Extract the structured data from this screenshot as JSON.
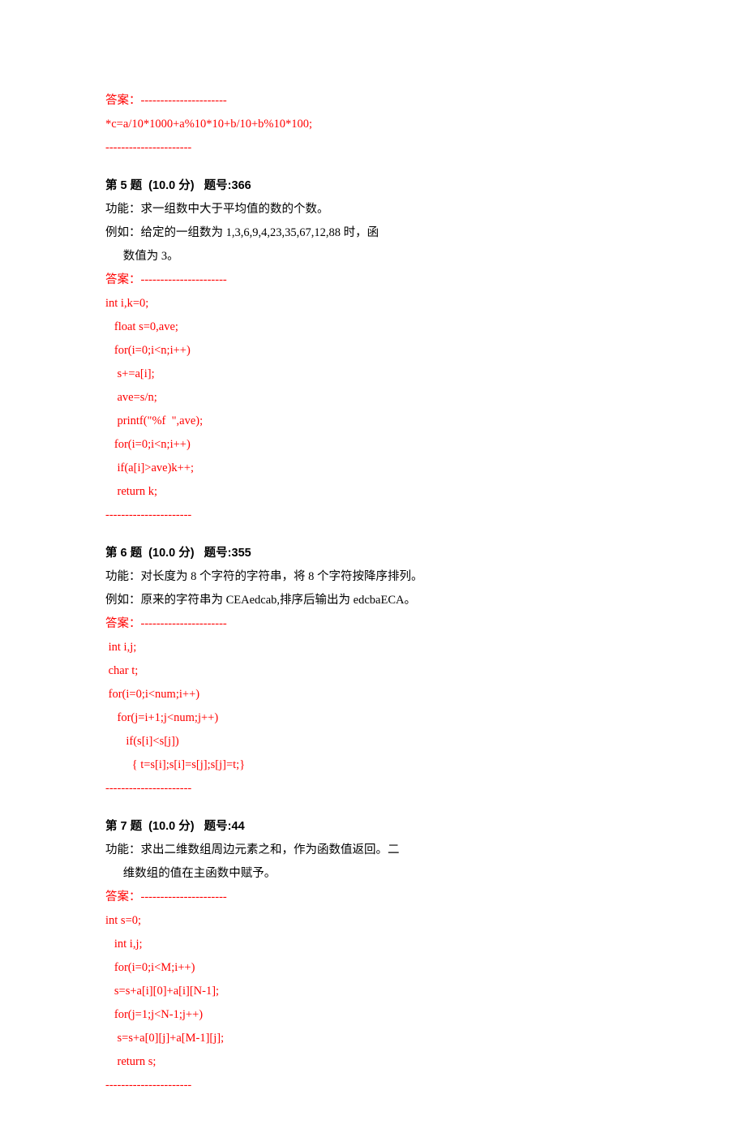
{
  "ans_label": "答案：",
  "sep": "----------------------",
  "q4": {
    "answer": "*c=a/10*1000+a%10*10+b/10+b%10*100;"
  },
  "q5": {
    "header": "第 5 题  (10.0 分)   题号:366",
    "desc1": "功能：求一组数中大于平均值的数的个数。",
    "desc2": "例如：给定的一组数为 1,3,6,9,4,23,35,67,12,88 时，函",
    "desc3": "      数值为 3。",
    "a1": "int i,k=0;",
    "a2": "   float s=0,ave;",
    "a3": "   for(i=0;i<n;i++)",
    "a4": "    s+=a[i];",
    "a5": "    ave=s/n;",
    "a6": "    printf(\"%f  \",ave);",
    "a7": "   for(i=0;i<n;i++)",
    "a8": "    if(a[i]>ave)k++;",
    "a9": "    return k;"
  },
  "q6": {
    "header": "第 6 题  (10.0 分)   题号:355",
    "desc1": "功能：对长度为 8 个字符的字符串，将 8 个字符按降序排列。",
    "desc2": "例如：原来的字符串为 CEAedcab,排序后输出为 edcbaECA。",
    "a1": " int i,j;",
    "a2": " char t;",
    "a3": " for(i=0;i<num;i++)",
    "a4": "    for(j=i+1;j<num;j++)",
    "a5": "       if(s[i]<s[j])",
    "a6": "         { t=s[i];s[i]=s[j];s[j]=t;}"
  },
  "q7": {
    "header": "第 7 题  (10.0 分)   题号:44",
    "desc1": "功能：求出二维数组周边元素之和，作为函数值返回。二",
    "desc2": "      维数组的值在主函数中赋予。",
    "a1": "int s=0;",
    "a2": "   int i,j;",
    "a3": "   for(i=0;i<M;i++)",
    "a4": "   s=s+a[i][0]+a[i][N-1];",
    "a5": "   for(j=1;j<N-1;j++)",
    "a6": "    s=s+a[0][j]+a[M-1][j];",
    "a7": "    return s;"
  }
}
